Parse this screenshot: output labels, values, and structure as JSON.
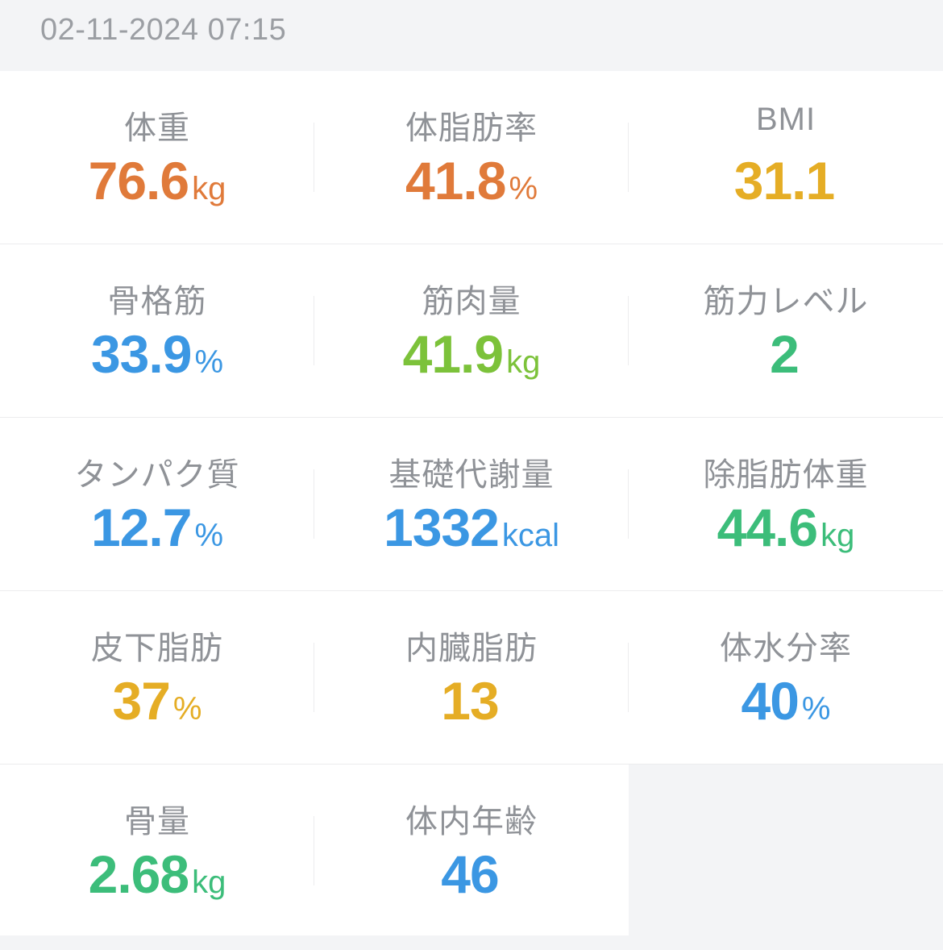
{
  "header": {
    "timestamp": "02-11-2024 07:15"
  },
  "colors": {
    "orange": "#e07a3a",
    "yellow": "#e5ad25",
    "blue": "#3b97e3",
    "lime": "#7cc23a",
    "green": "#3cbd7a",
    "label_gray": "#8f9297",
    "background": "#f3f4f6"
  },
  "metrics": [
    {
      "label": "体重",
      "value": "76.6",
      "unit": "kg",
      "color": "orange"
    },
    {
      "label": "体脂肪率",
      "value": "41.8",
      "unit": "%",
      "color": "orange"
    },
    {
      "label": "BMI",
      "value": "31.1",
      "unit": "",
      "color": "yellow"
    },
    {
      "label": "骨格筋",
      "value": "33.9",
      "unit": "%",
      "color": "blue"
    },
    {
      "label": "筋肉量",
      "value": "41.9",
      "unit": "kg",
      "color": "lime"
    },
    {
      "label": "筋力レベル",
      "value": "2",
      "unit": "",
      "color": "green"
    },
    {
      "label": "タンパク質",
      "value": "12.7",
      "unit": "%",
      "color": "blue"
    },
    {
      "label": "基礎代謝量",
      "value": "1332",
      "unit": "kcal",
      "color": "blue"
    },
    {
      "label": "除脂肪体重",
      "value": "44.6",
      "unit": "kg",
      "color": "green"
    },
    {
      "label": "皮下脂肪",
      "value": "37",
      "unit": "%",
      "color": "yellow"
    },
    {
      "label": "内臓脂肪",
      "value": "13",
      "unit": "",
      "color": "yellow"
    },
    {
      "label": "体水分率",
      "value": "40",
      "unit": "%",
      "color": "blue"
    },
    {
      "label": "骨量",
      "value": "2.68",
      "unit": "kg",
      "color": "green"
    },
    {
      "label": "体内年齢",
      "value": "46",
      "unit": "",
      "color": "blue"
    }
  ]
}
